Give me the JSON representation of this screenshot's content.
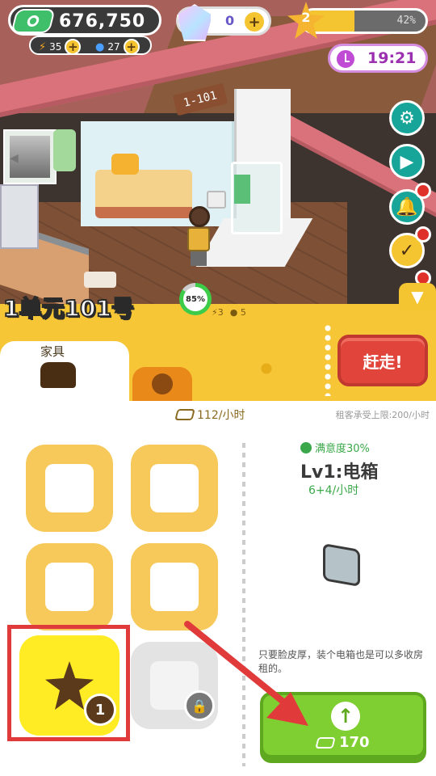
{
  "hud": {
    "money": "676,750",
    "energy": "35",
    "water": "27",
    "gems": "0",
    "level": "2",
    "level_progress_pct": "42%",
    "level_progress": 0.42,
    "clock": "19:21"
  },
  "scene": {
    "room_sign": "1-101",
    "room_title": "1单元101号",
    "satisfaction_ring": "85%",
    "satisfaction_value": 0.85,
    "mini_energy": "3",
    "mini_water": "5"
  },
  "panel": {
    "tab_furniture": "家具",
    "evict_label": "赶走!",
    "rent_per_hour": "112/小时",
    "rent_cap": "租客承受上限:200/小时",
    "selected_badge": "1"
  },
  "detail": {
    "satisfaction": "满意度30%",
    "name": "Lv1:电箱",
    "rent": "6+4/小时",
    "description": "只要脸皮厚，装个电箱也是可以多收房租的。",
    "upgrade_cost": "170"
  },
  "colors": {
    "accent": "#f6c637",
    "evict": "#e0443a",
    "upgrade": "#7fcf32",
    "highlight": "#e03a3a"
  }
}
